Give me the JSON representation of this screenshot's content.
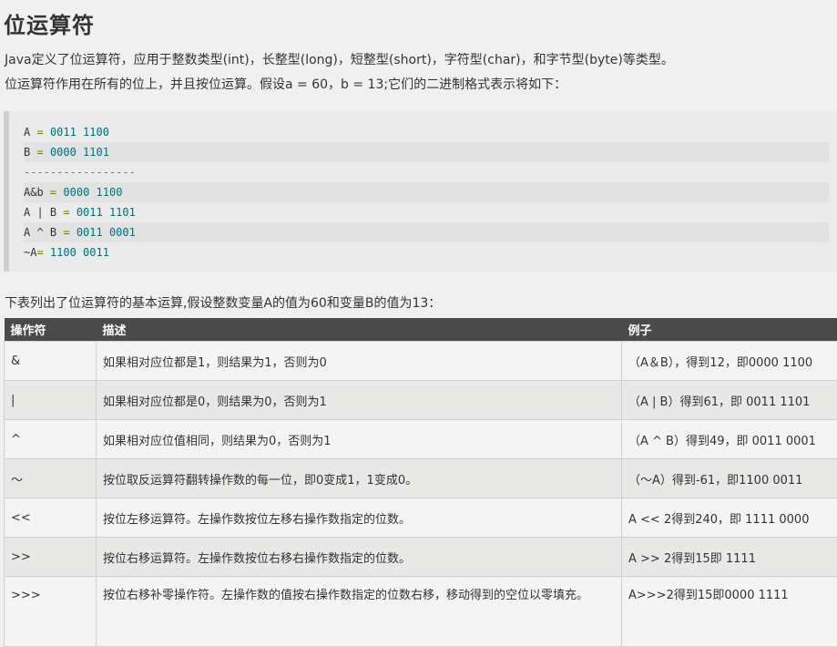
{
  "title": "位运算符",
  "intro": {
    "line1": "Java定义了位运算符，应用于整数类型(int)，长整型(long)，短整型(short)，字符型(char)，和字节型(byte)等类型。",
    "line2": "位运算符作用在所有的位上，并且按位运算。假设a = 60，b = 13;它们的二进制格式表示将如下："
  },
  "code": {
    "a_name": "A",
    "a_val": "0011 1100",
    "b_name": "B",
    "b_val": "0000 1101",
    "sep": "-----------------",
    "and_name": "A&b",
    "and_val": "0000 1100",
    "or_name": "A | B",
    "or_val": "0011 1101",
    "xor_name": "A ^ B",
    "xor_val": "0011 0001",
    "not_name": "~A",
    "not_val": "1100 0011"
  },
  "table_intro": "下表列出了位运算符的基本运算,假设整数变量A的值为60和变量B的值为13：",
  "table": {
    "headers": [
      "操作符",
      "描述",
      "例子"
    ],
    "rows": [
      {
        "op": "&",
        "desc": "如果相对应位都是1，则结果为1，否则为0",
        "example": "（A＆B），得到12，即0000 1100"
      },
      {
        "op": "|",
        "desc": "如果相对应位都是0，则结果为0，否则为1",
        "example": "（A | B）得到61，即 0011 1101"
      },
      {
        "op": "^",
        "desc": "如果相对应位值相同，则结果为0，否则为1",
        "example": "（A ^ B）得到49，即 0011 0001"
      },
      {
        "op": "〜",
        "desc": "按位取反运算符翻转操作数的每一位，即0变成1，1变成0。",
        "example": "（〜A）得到-61，即1100 0011"
      },
      {
        "op": "<<",
        "desc": "按位左移运算符。左操作数按位左移右操作数指定的位数。",
        "example": "A << 2得到240，即 1111 0000"
      },
      {
        "op": ">>",
        "desc": "按位右移运算符。左操作数按位右移右操作数指定的位数。",
        "example": "A >> 2得到15即 1111"
      },
      {
        "op": ">>>",
        "desc": "按位右移补零操作符。左操作数的值按右操作数指定的位数右移，移动得到的空位以零填充。",
        "example": "A>>>2得到15即0000 1111"
      }
    ]
  }
}
